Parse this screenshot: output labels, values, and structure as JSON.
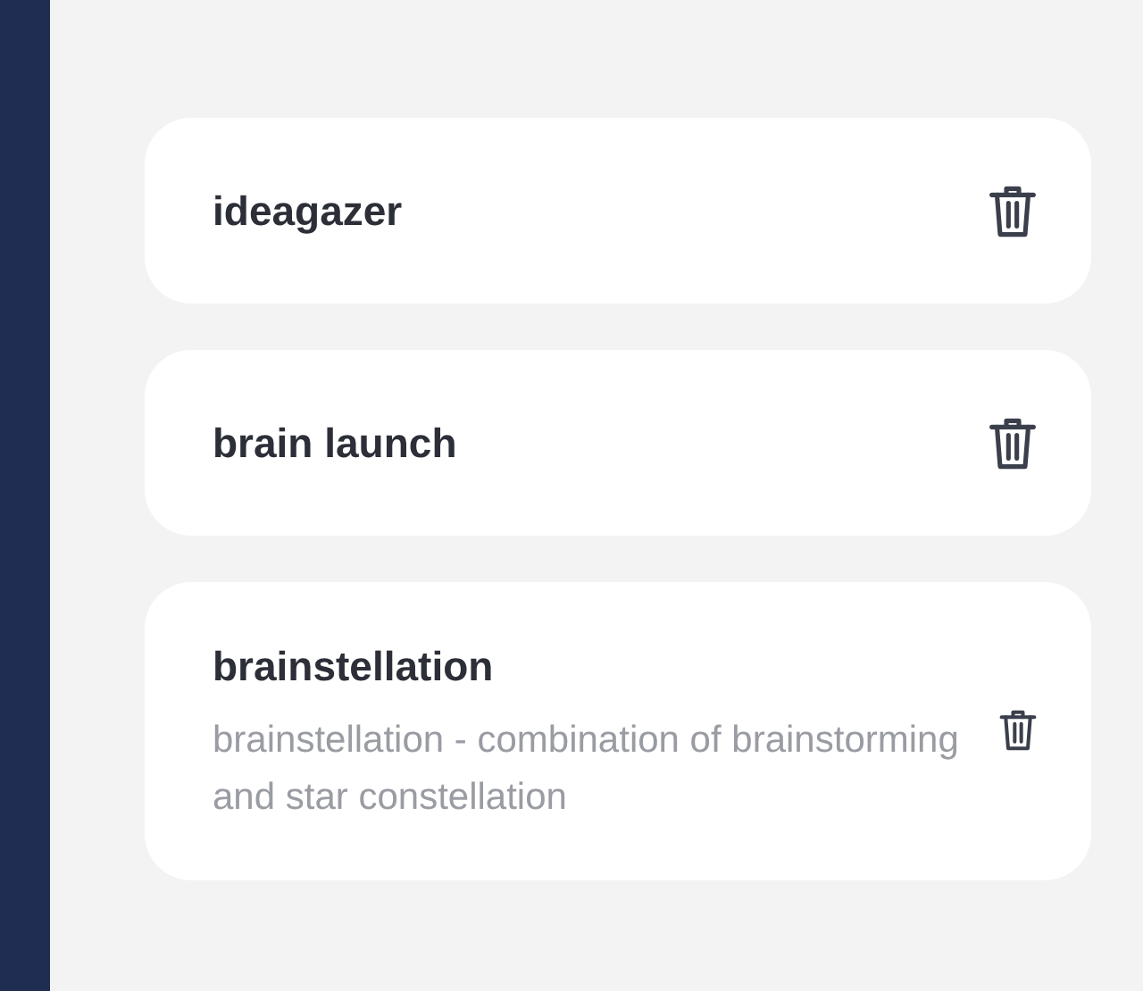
{
  "ideas": [
    {
      "title": "ideagazer"
    },
    {
      "title": "brain launch"
    },
    {
      "title": "brainstellation",
      "description": "brainstellation - combination of brainstorming and star constellation"
    }
  ]
}
